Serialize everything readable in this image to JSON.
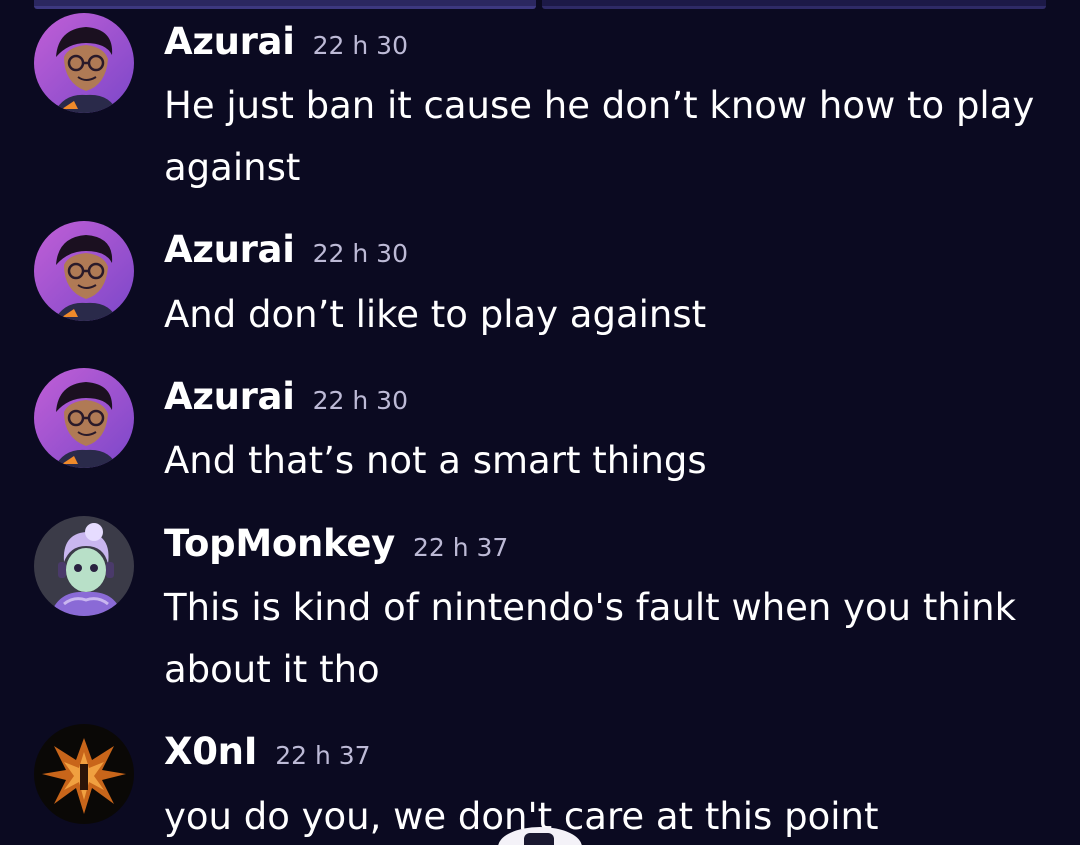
{
  "messages": [
    {
      "author": "Azurai",
      "time": "22 h 30",
      "text": "He just ban it cause he don’t know how to play against",
      "avatar": "azurai-avatar"
    },
    {
      "author": "Azurai",
      "time": "22 h 30",
      "text": "And don’t like to play against",
      "avatar": "azurai-avatar"
    },
    {
      "author": "Azurai",
      "time": "22 h 30",
      "text": "And that’s not a smart things",
      "avatar": "azurai-avatar"
    },
    {
      "author": "TopMonkey",
      "time": "22 h 37",
      "text": "This is kind of nintendo's fault when you think about it tho",
      "avatar": "topmonkey-avatar"
    },
    {
      "author": "X0nI",
      "time": "22 h 37",
      "text": "you do you, we don't care at this point",
      "avatar": "x0ni-avatar"
    }
  ],
  "colors": {
    "background": "#0b0a21",
    "author_text": "#ffffff",
    "timestamp_text": "#bdbad6",
    "message_text": "#ffffff"
  }
}
